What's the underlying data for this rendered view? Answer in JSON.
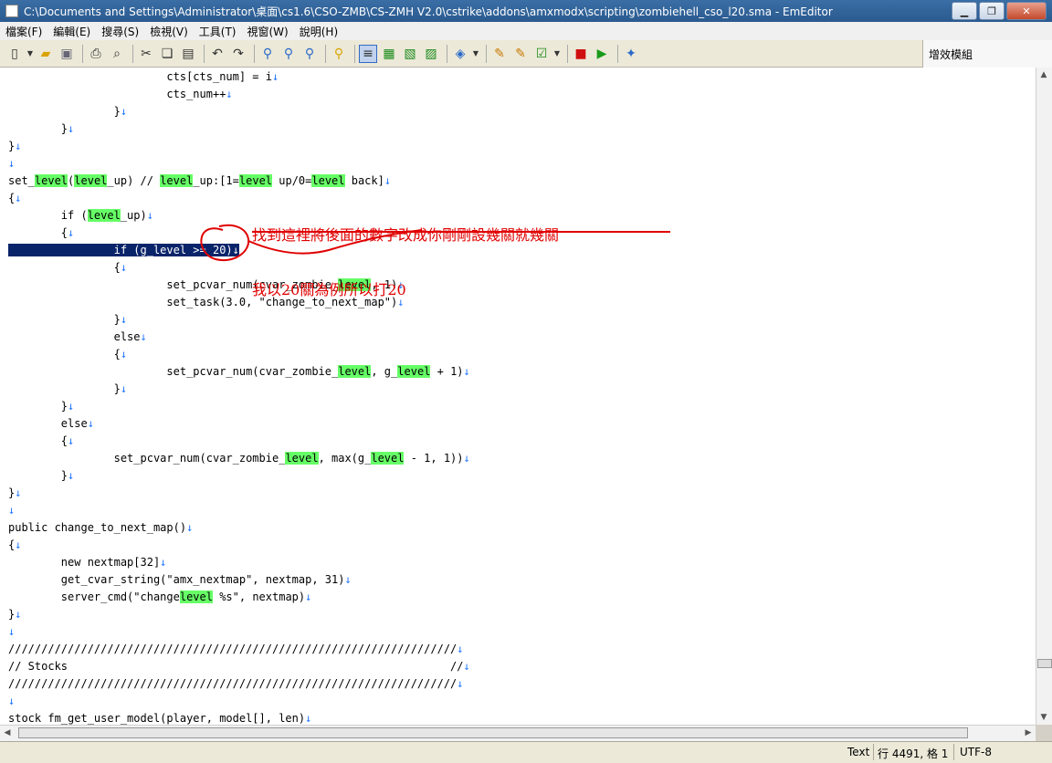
{
  "window": {
    "title": "C:\\Documents and Settings\\Administrator\\桌面\\cs1.6\\CSO-ZMB\\CS-ZMH V2.0\\cstrike\\addons\\amxmodx\\scripting\\zombiehell_cso_l20.sma - EmEditor"
  },
  "menu": [
    "檔案(F)",
    "編輯(E)",
    "搜尋(S)",
    "檢視(V)",
    "工具(T)",
    "視窗(W)",
    "說明(H)"
  ],
  "plugins_panel": {
    "label": "增效模組"
  },
  "code_lines": [
    [
      {
        "t": "                        cts[cts_num] = i"
      },
      {
        "t": "↓",
        "c": "nl"
      }
    ],
    [
      {
        "t": "                        cts_num++"
      },
      {
        "t": "↓",
        "c": "nl"
      }
    ],
    [
      {
        "t": "                }"
      },
      {
        "t": "↓",
        "c": "nl"
      }
    ],
    [
      {
        "t": "        }"
      },
      {
        "t": "↓",
        "c": "nl"
      }
    ],
    [
      {
        "t": "}"
      },
      {
        "t": "↓",
        "c": "nl"
      }
    ],
    [
      {
        "t": "↓",
        "c": "nl"
      }
    ],
    [
      {
        "t": "set_"
      },
      {
        "t": "level",
        "c": "hl"
      },
      {
        "t": "("
      },
      {
        "t": "level",
        "c": "hl"
      },
      {
        "t": "_up) // "
      },
      {
        "t": "level",
        "c": "hl"
      },
      {
        "t": "_up:[1="
      },
      {
        "t": "level",
        "c": "hl"
      },
      {
        "t": " up/0="
      },
      {
        "t": "level",
        "c": "hl"
      },
      {
        "t": " back]"
      },
      {
        "t": "↓",
        "c": "nl"
      }
    ],
    [
      {
        "t": "{"
      },
      {
        "t": "↓",
        "c": "nl"
      }
    ],
    [
      {
        "t": "        if ("
      },
      {
        "t": "level",
        "c": "hl"
      },
      {
        "t": "_up)"
      },
      {
        "t": "↓",
        "c": "nl"
      }
    ],
    [
      {
        "t": "        {"
      },
      {
        "t": "↓",
        "c": "nl"
      }
    ],
    [
      {
        "t": "                if (g_level >= 20)↓",
        "c": "sel"
      }
    ],
    [
      {
        "t": "                {"
      },
      {
        "t": "↓",
        "c": "nl"
      }
    ],
    [
      {
        "t": "                        set_pcvar_num(cvar_zombie_"
      },
      {
        "t": "level",
        "c": "hl"
      },
      {
        "t": ", 1)"
      },
      {
        "t": "↓",
        "c": "nl"
      }
    ],
    [
      {
        "t": "                        set_task(3.0, \"change_to_next_map\")"
      },
      {
        "t": "↓",
        "c": "nl"
      }
    ],
    [
      {
        "t": "                }"
      },
      {
        "t": "↓",
        "c": "nl"
      }
    ],
    [
      {
        "t": "                else"
      },
      {
        "t": "↓",
        "c": "nl"
      }
    ],
    [
      {
        "t": "                {"
      },
      {
        "t": "↓",
        "c": "nl"
      }
    ],
    [
      {
        "t": "                        set_pcvar_num(cvar_zombie_"
      },
      {
        "t": "level",
        "c": "hl"
      },
      {
        "t": ", g_"
      },
      {
        "t": "level",
        "c": "hl"
      },
      {
        "t": " + 1)"
      },
      {
        "t": "↓",
        "c": "nl"
      }
    ],
    [
      {
        "t": "                }"
      },
      {
        "t": "↓",
        "c": "nl"
      }
    ],
    [
      {
        "t": "        }"
      },
      {
        "t": "↓",
        "c": "nl"
      }
    ],
    [
      {
        "t": "        else"
      },
      {
        "t": "↓",
        "c": "nl"
      }
    ],
    [
      {
        "t": "        {"
      },
      {
        "t": "↓",
        "c": "nl"
      }
    ],
    [
      {
        "t": "                set_pcvar_num(cvar_zombie_"
      },
      {
        "t": "level",
        "c": "hl"
      },
      {
        "t": ", max(g_"
      },
      {
        "t": "level",
        "c": "hl"
      },
      {
        "t": " - 1, 1))"
      },
      {
        "t": "↓",
        "c": "nl"
      }
    ],
    [
      {
        "t": "        }"
      },
      {
        "t": "↓",
        "c": "nl"
      }
    ],
    [
      {
        "t": "}"
      },
      {
        "t": "↓",
        "c": "nl"
      }
    ],
    [
      {
        "t": "↓",
        "c": "nl"
      }
    ],
    [
      {
        "t": "public change_to_next_map()"
      },
      {
        "t": "↓",
        "c": "nl"
      }
    ],
    [
      {
        "t": "{"
      },
      {
        "t": "↓",
        "c": "nl"
      }
    ],
    [
      {
        "t": "        new nextmap[32]"
      },
      {
        "t": "↓",
        "c": "nl"
      }
    ],
    [
      {
        "t": "        get_cvar_string(\"amx_nextmap\", nextmap, 31)"
      },
      {
        "t": "↓",
        "c": "nl"
      }
    ],
    [
      {
        "t": "        server_cmd(\"change"
      },
      {
        "t": "level",
        "c": "hl"
      },
      {
        "t": " %s\", nextmap)"
      },
      {
        "t": "↓",
        "c": "nl"
      }
    ],
    [
      {
        "t": "}"
      },
      {
        "t": "↓",
        "c": "nl"
      }
    ],
    [
      {
        "t": "↓",
        "c": "nl"
      }
    ],
    [
      {
        "t": "////////////////////////////////////////////////////////////////////"
      },
      {
        "t": "↓",
        "c": "nl"
      }
    ],
    [
      {
        "t": "// Stocks                                                          //"
      },
      {
        "t": "↓",
        "c": "nl"
      }
    ],
    [
      {
        "t": "////////////////////////////////////////////////////////////////////"
      },
      {
        "t": "↓",
        "c": "nl"
      }
    ],
    [
      {
        "t": "↓",
        "c": "nl"
      }
    ],
    [
      {
        "t": "stock fm_get_user_model(player, model[], len)"
      },
      {
        "t": "↓",
        "c": "nl"
      }
    ]
  ],
  "annotation": {
    "line1": "找到這裡將後面的數字改成你剛剛設幾關就幾關",
    "line2": "我以20關為例所以打20",
    "color": "#e00000"
  },
  "status": {
    "mode": "Text",
    "position": "行 4491, 格 1",
    "encoding": "UTF-8"
  },
  "colors": {
    "highlight": "#66ff66",
    "selection": "#0a246a",
    "newline_mark": "#1f74ff"
  }
}
